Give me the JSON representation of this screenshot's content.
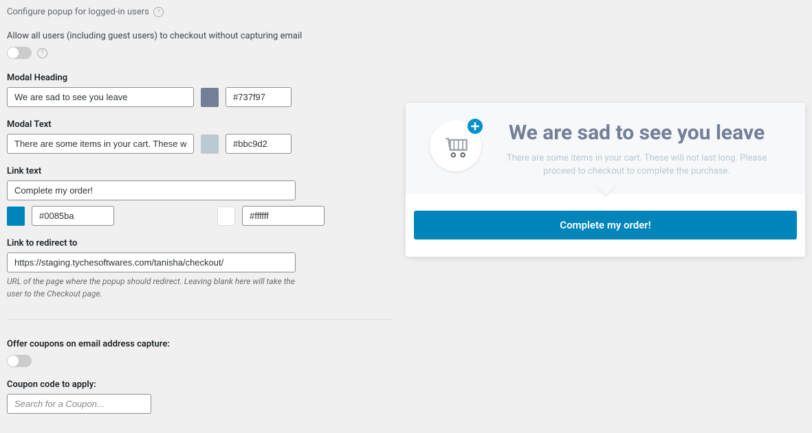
{
  "header": {
    "configure_popup_label": "Configure popup for logged-in users"
  },
  "allow_all": {
    "label": "Allow all users (including guest users) to checkout without capturing email"
  },
  "modal_heading": {
    "label": "Modal Heading",
    "value": "We are sad to see you leave",
    "color": "#737f97"
  },
  "modal_text": {
    "label": "Modal Text",
    "value": "There are some items in your cart. These will not last long. Please proceed to checkout to complete the purchase.",
    "input_value": "There are some items in your cart. These will not l",
    "color": "#bbc9d2"
  },
  "link_text": {
    "label": "Link text",
    "value": "Complete my order!",
    "bg_color": "#0085ba",
    "fg_color": "#ffffff"
  },
  "redirect": {
    "label": "Link to redirect to",
    "value": "https://staging.tychesoftwares.com/tanisha/checkout/",
    "help": "URL of the page where the popup should redirect. Leaving blank here will take the user to the Checkout page."
  },
  "offer_coupons": {
    "label": "Offer coupons on email address capture:"
  },
  "coupon_code": {
    "label": "Coupon code to apply:",
    "placeholder": "Search for a Coupon..."
  },
  "preview": {
    "heading": "We are sad to see you leave",
    "desc": "There are some items in your cart. These will not last long. Please proceed to checkout to complete the purchase.",
    "button": "Complete my order!"
  }
}
